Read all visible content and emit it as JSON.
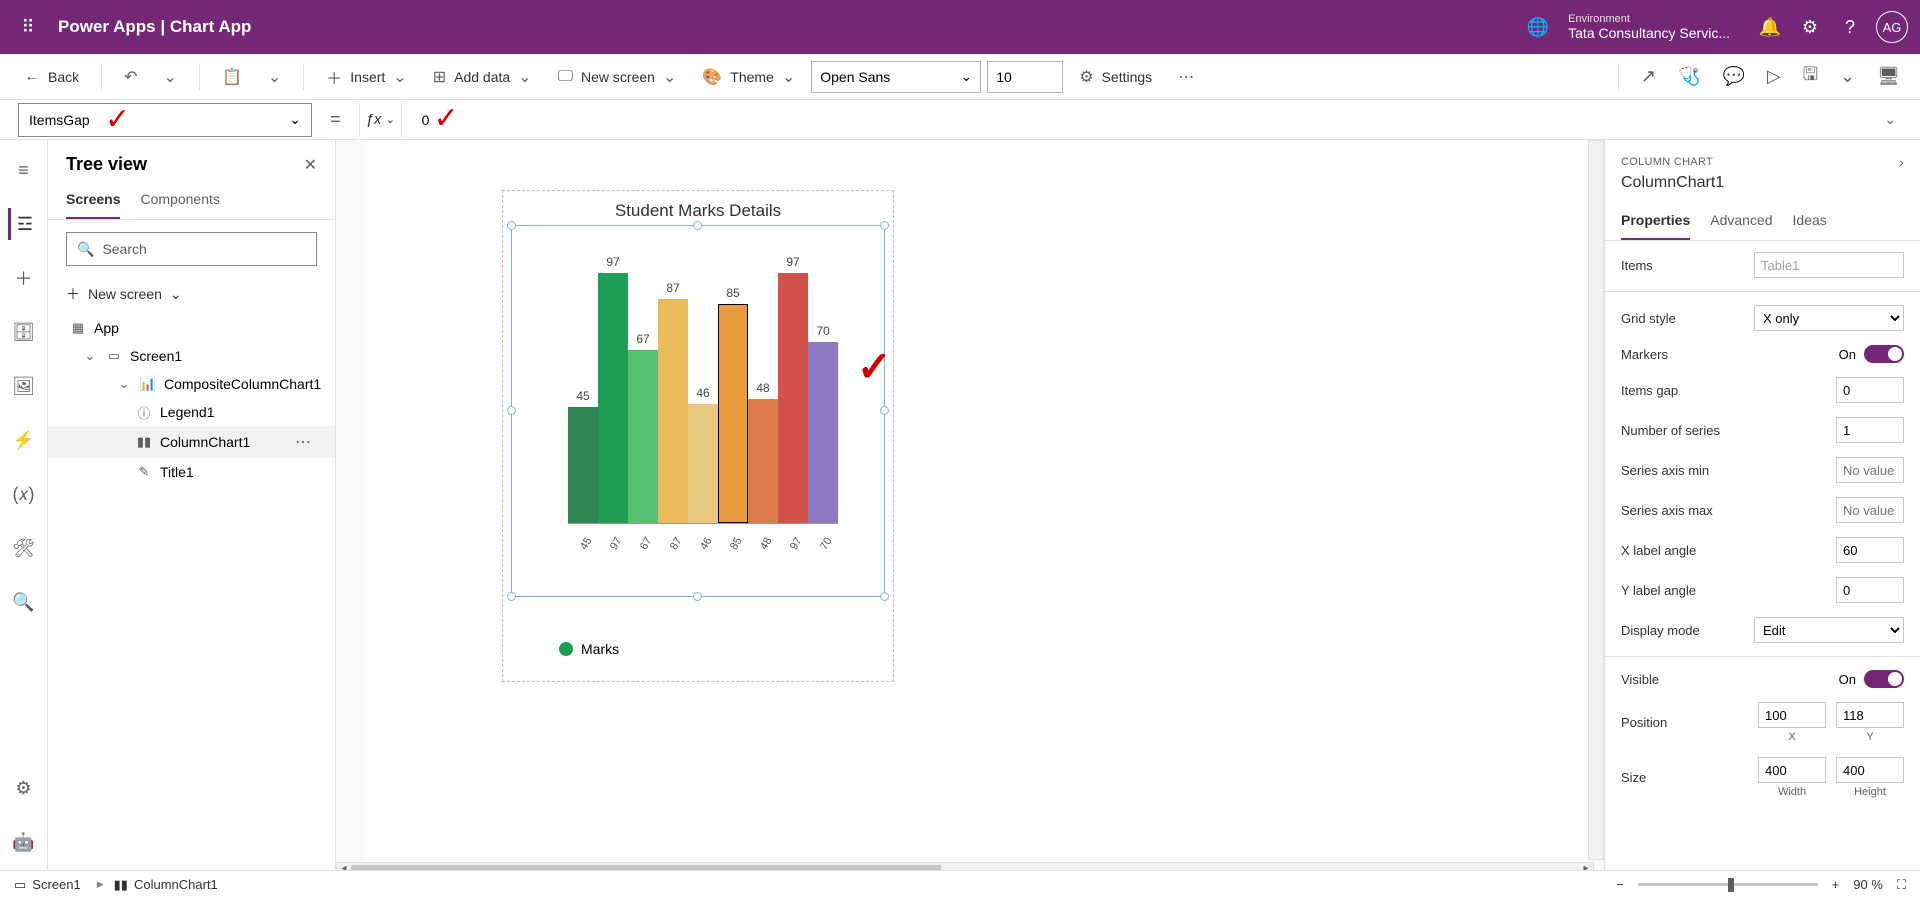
{
  "header": {
    "app": "Power Apps",
    "sep": "|",
    "doc": "Chart App",
    "env_label": "Environment",
    "env_name": "Tata Consultancy Servic...",
    "avatar": "AG"
  },
  "toolbar": {
    "back": "Back",
    "insert": "Insert",
    "add_data": "Add data",
    "new_screen": "New screen",
    "theme": "Theme",
    "font": "Open Sans",
    "font_size": "10",
    "settings": "Settings"
  },
  "formula_bar": {
    "property": "ItemsGap",
    "value": "0"
  },
  "treeview": {
    "title": "Tree view",
    "tab_screens": "Screens",
    "tab_components": "Components",
    "search_ph": "Search",
    "new_screen": "New screen",
    "items": {
      "app": "App",
      "screen1": "Screen1",
      "composite": "CompositeColumnChart1",
      "legend": "Legend1",
      "columnchart": "ColumnChart1",
      "title": "Title1"
    }
  },
  "chart": {
    "title": "Student Marks Details",
    "legend_label": "Marks"
  },
  "chart_data": {
    "type": "bar",
    "categories": [
      "45",
      "97",
      "67",
      "87",
      "46",
      "85",
      "48",
      "97",
      "70"
    ],
    "values": [
      45,
      97,
      67,
      87,
      46,
      85,
      48,
      97,
      70
    ],
    "title": "Student Marks Details",
    "xlabel": "",
    "ylabel": "",
    "ylim": [
      0,
      100
    ],
    "colors": [
      "#2e8653",
      "#1f9d55",
      "#56c271",
      "#e9bb5d",
      "#e8c97f",
      "#e89a3f",
      "#df7b4a",
      "#d2514a",
      "#8d78c2"
    ]
  },
  "footer": {
    "screen": "Screen1",
    "chart": "ColumnChart1",
    "zoom": "90  %"
  },
  "right": {
    "type": "COLUMN CHART",
    "name": "ColumnChart1",
    "tab_props": "Properties",
    "tab_adv": "Advanced",
    "tab_ideas": "Ideas",
    "items": "Items",
    "items_val": "Table1",
    "grid_style": "Grid style",
    "grid_style_val": "X only",
    "markers": "Markers",
    "markers_on": "On",
    "items_gap": "Items gap",
    "items_gap_val": "0",
    "num_series": "Number of series",
    "num_series_val": "1",
    "axis_min": "Series axis min",
    "axis_min_ph": "No value",
    "axis_max": "Series axis max",
    "axis_max_ph": "No value",
    "xangle": "X label angle",
    "xangle_val": "60",
    "yangle": "Y label angle",
    "yangle_val": "0",
    "display_mode": "Display mode",
    "display_mode_val": "Edit",
    "visible": "Visible",
    "visible_on": "On",
    "position": "Position",
    "pos_x": "100",
    "pos_y": "118",
    "pos_x_lbl": "X",
    "pos_y_lbl": "Y",
    "size": "Size",
    "width": "400",
    "height": "400",
    "width_lbl": "Width",
    "height_lbl": "Height"
  }
}
